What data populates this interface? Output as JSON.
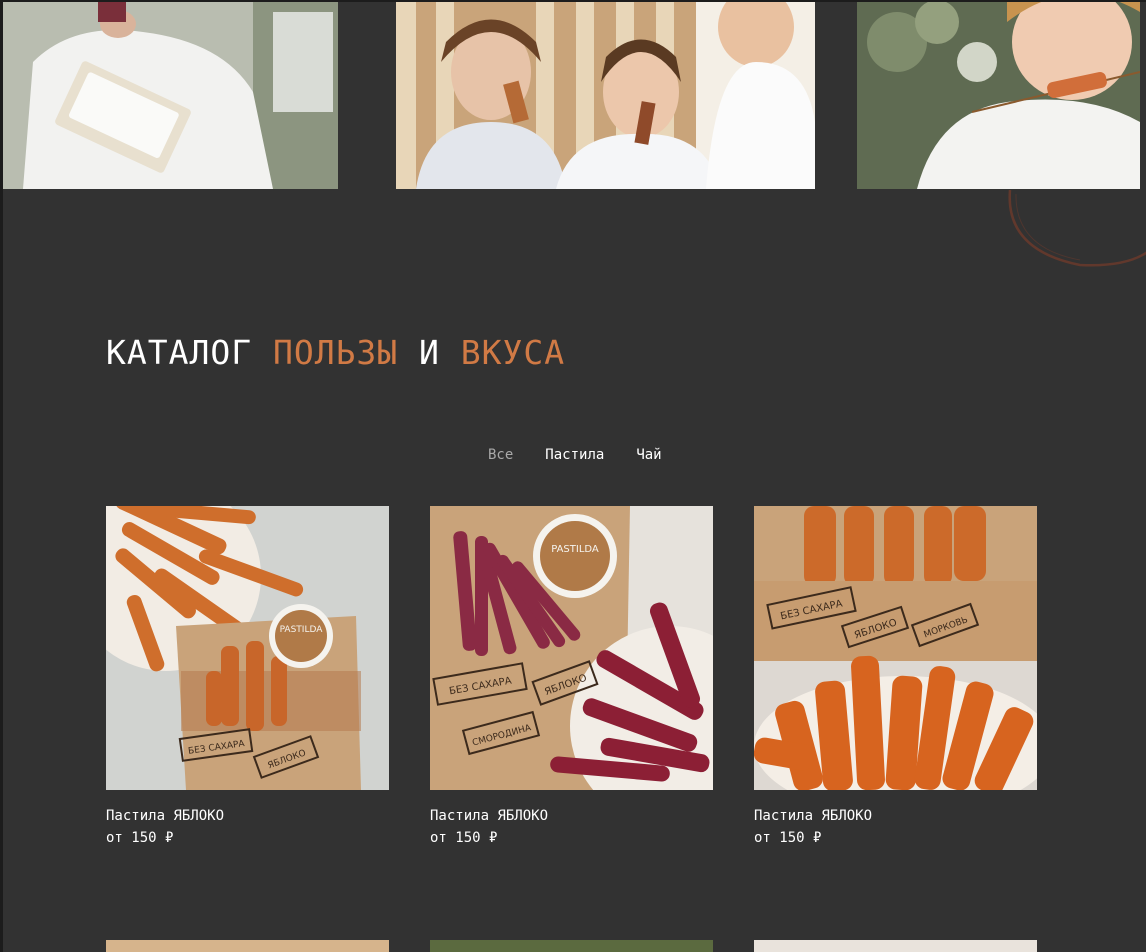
{
  "heading": {
    "part1": "КАТАЛОГ",
    "part2": "ПОЛЬЗЫ",
    "part3": "И",
    "part4": "ВКУСА"
  },
  "colors": {
    "background": "#323232",
    "accent": "#d17a45",
    "text": "#ffffff",
    "muted": "#a9a9a9"
  },
  "filters": [
    {
      "label": "Все",
      "active": true
    },
    {
      "label": "Пастила",
      "active": false
    },
    {
      "label": "Чай",
      "active": false
    }
  ],
  "products": [
    {
      "name": "Пастила ЯБЛОКО",
      "price": "от 150 ₽",
      "tags": [
        "БЕЗ САХАРА",
        "ЯБЛОКО"
      ],
      "brand": "PASTILDA"
    },
    {
      "name": "Пастила ЯБЛОКО",
      "price": "от 150 ₽",
      "tags": [
        "БЕЗ САХАРА",
        "ЯБЛОКО",
        "СМОРОДИНА"
      ],
      "brand": "PASTILDA"
    },
    {
      "name": "Пастила ЯБЛОКО",
      "price": "от 150 ₽",
      "tags": [
        "БЕЗ САХАРА",
        "ЯБЛОКО",
        "МОРКОВЬ"
      ]
    }
  ]
}
